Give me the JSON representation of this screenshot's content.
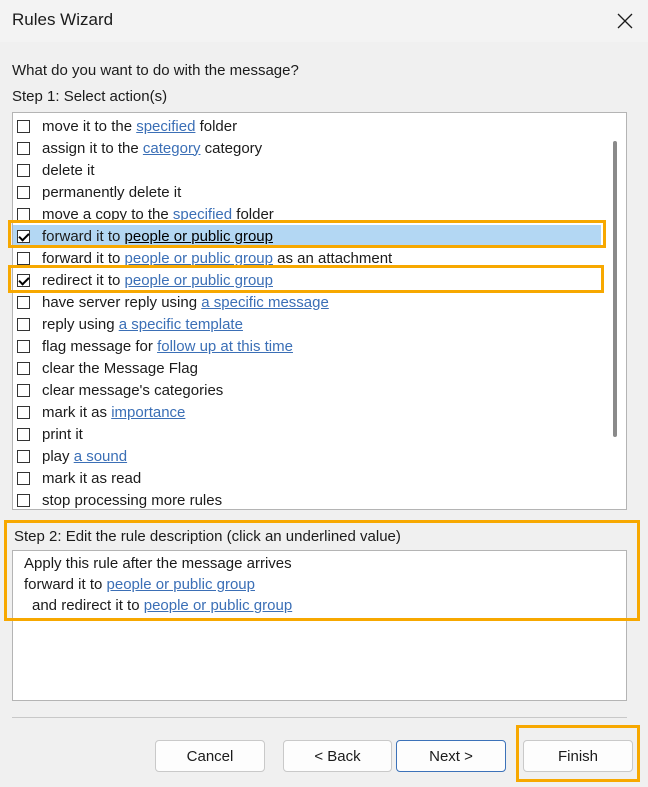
{
  "window": {
    "title": "Rules Wizard"
  },
  "question": "What do you want to do with the message?",
  "step1_label": "Step 1: Select action(s)",
  "actions": [
    {
      "pre": "move it to the ",
      "link": "specified",
      "post": " folder",
      "checked": false
    },
    {
      "pre": "assign it to the ",
      "link": "category",
      "post": " category",
      "checked": false
    },
    {
      "pre": "delete it",
      "link": "",
      "post": "",
      "checked": false
    },
    {
      "pre": "permanently delete it",
      "link": "",
      "post": "",
      "checked": false
    },
    {
      "pre": "move a copy to the ",
      "link": "specified",
      "post": " folder",
      "checked": false
    },
    {
      "pre": "forward it to ",
      "link": "people or public group",
      "post": "",
      "checked": true
    },
    {
      "pre": "forward it to ",
      "link": "people or public group",
      "post": " as an attachment",
      "checked": false
    },
    {
      "pre": "redirect it to ",
      "link": "people or public group",
      "post": "",
      "checked": true
    },
    {
      "pre": "have server reply using ",
      "link": "a specific message",
      "post": "",
      "checked": false
    },
    {
      "pre": "reply using ",
      "link": "a specific template",
      "post": "",
      "checked": false
    },
    {
      "pre": "flag message for ",
      "link": "follow up at this time",
      "post": "",
      "checked": false
    },
    {
      "pre": "clear the Message Flag",
      "link": "",
      "post": "",
      "checked": false
    },
    {
      "pre": "clear message's categories",
      "link": "",
      "post": "",
      "checked": false
    },
    {
      "pre": "mark it as ",
      "link": "importance",
      "post": "",
      "checked": false
    },
    {
      "pre": "print it",
      "link": "",
      "post": "",
      "checked": false
    },
    {
      "pre": "play ",
      "link": "a sound",
      "post": "",
      "checked": false
    },
    {
      "pre": "mark it as read",
      "link": "",
      "post": "",
      "checked": false
    },
    {
      "pre": "stop processing more rules",
      "link": "",
      "post": "",
      "checked": false
    }
  ],
  "step2_label": "Step 2: Edit the rule description (click an underlined value)",
  "description": {
    "line1": "Apply this rule after the message arrives",
    "line2_pre": "forward it to ",
    "line2_link": "people or public group",
    "line3_pre": "and redirect it to ",
    "line3_link": "people or public group"
  },
  "buttons": {
    "cancel": "Cancel",
    "back": "< Back",
    "next": "Next >",
    "finish": "Finish"
  },
  "colors": {
    "link": "#3b6fb6",
    "highlight": "#f7a800",
    "selection": "#b3d7f3"
  },
  "icons": {
    "close": "close-icon"
  }
}
